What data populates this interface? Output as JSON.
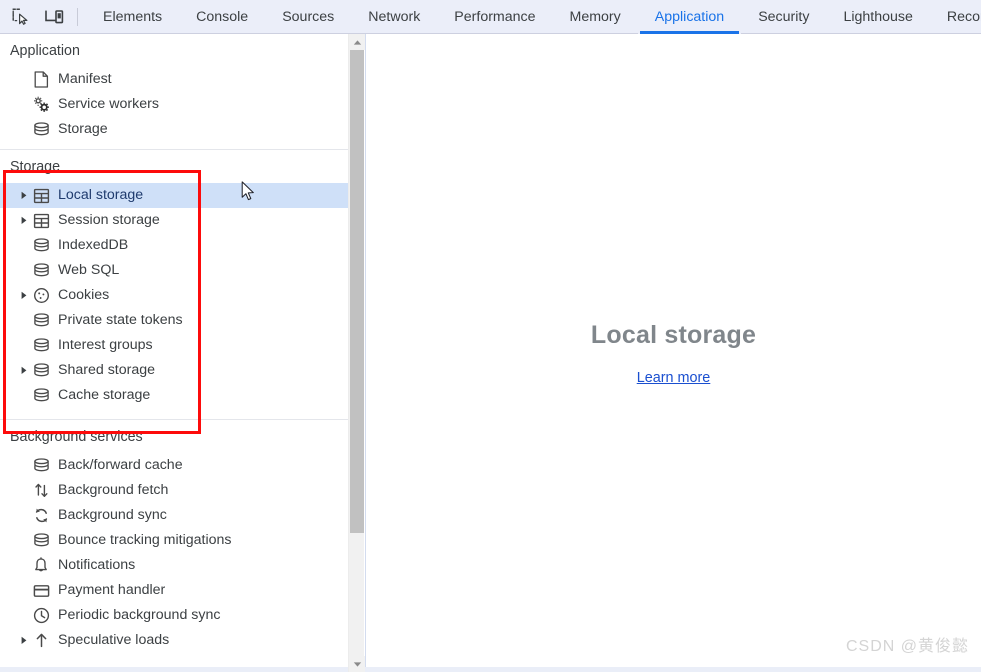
{
  "toolbar": {
    "inspect_icon": "inspect-element-icon",
    "device_icon": "device-toolbar-icon",
    "tabs": [
      {
        "label": "Elements",
        "active": false
      },
      {
        "label": "Console",
        "active": false
      },
      {
        "label": "Sources",
        "active": false
      },
      {
        "label": "Network",
        "active": false
      },
      {
        "label": "Performance",
        "active": false
      },
      {
        "label": "Memory",
        "active": false
      },
      {
        "label": "Application",
        "active": true
      },
      {
        "label": "Security",
        "active": false
      },
      {
        "label": "Lighthouse",
        "active": false
      },
      {
        "label": "Recorder",
        "active": false
      }
    ]
  },
  "sidebar": {
    "sections": [
      {
        "title": "Application",
        "items": [
          {
            "label": "Manifest",
            "icon": "document-icon",
            "expandable": false,
            "selected": false
          },
          {
            "label": "Service workers",
            "icon": "gears-icon",
            "expandable": false,
            "selected": false
          },
          {
            "label": "Storage",
            "icon": "database-icon",
            "expandable": false,
            "selected": false
          }
        ]
      },
      {
        "title": "Storage",
        "items": [
          {
            "label": "Local storage",
            "icon": "table-icon",
            "expandable": true,
            "selected": true
          },
          {
            "label": "Session storage",
            "icon": "table-icon",
            "expandable": true,
            "selected": false
          },
          {
            "label": "IndexedDB",
            "icon": "database-icon",
            "expandable": false,
            "selected": false
          },
          {
            "label": "Web SQL",
            "icon": "database-icon",
            "expandable": false,
            "selected": false
          },
          {
            "label": "Cookies",
            "icon": "cookie-icon",
            "expandable": true,
            "selected": false
          },
          {
            "label": "Private state tokens",
            "icon": "database-icon",
            "expandable": false,
            "selected": false
          },
          {
            "label": "Interest groups",
            "icon": "database-icon",
            "expandable": false,
            "selected": false
          },
          {
            "label": "Shared storage",
            "icon": "database-icon",
            "expandable": true,
            "selected": false
          },
          {
            "label": "Cache storage",
            "icon": "database-icon",
            "expandable": false,
            "selected": false
          }
        ]
      },
      {
        "title": "Background services",
        "items": [
          {
            "label": "Back/forward cache",
            "icon": "database-icon",
            "expandable": false,
            "selected": false
          },
          {
            "label": "Background fetch",
            "icon": "updown-arrows-icon",
            "expandable": false,
            "selected": false
          },
          {
            "label": "Background sync",
            "icon": "sync-icon",
            "expandable": false,
            "selected": false
          },
          {
            "label": "Bounce tracking mitigations",
            "icon": "database-icon",
            "expandable": false,
            "selected": false
          },
          {
            "label": "Notifications",
            "icon": "bell-icon",
            "expandable": false,
            "selected": false
          },
          {
            "label": "Payment handler",
            "icon": "card-icon",
            "expandable": false,
            "selected": false
          },
          {
            "label": "Periodic background sync",
            "icon": "clock-icon",
            "expandable": false,
            "selected": false
          },
          {
            "label": "Speculative loads",
            "icon": "up-arrow-icon",
            "expandable": true,
            "selected": false
          }
        ]
      }
    ]
  },
  "main": {
    "title": "Local storage",
    "link_label": "Learn more"
  },
  "annotation": {
    "box_color": "#fd0b0b",
    "target_section": "Storage"
  },
  "scrollbar": {
    "up_arrow_icon": "scroll-up-arrow-icon",
    "down_arrow_icon": "scroll-down-arrow-icon"
  },
  "watermark": {
    "text": "CSDN @黄俊懿"
  },
  "colors": {
    "accent": "#1a73e8",
    "toolbar_bg": "#ebeef9",
    "selection_bg": "#cfe0f8",
    "annotation_red": "#fd0b0b",
    "link": "#1a4fd0",
    "muted_title": "#80868b"
  }
}
